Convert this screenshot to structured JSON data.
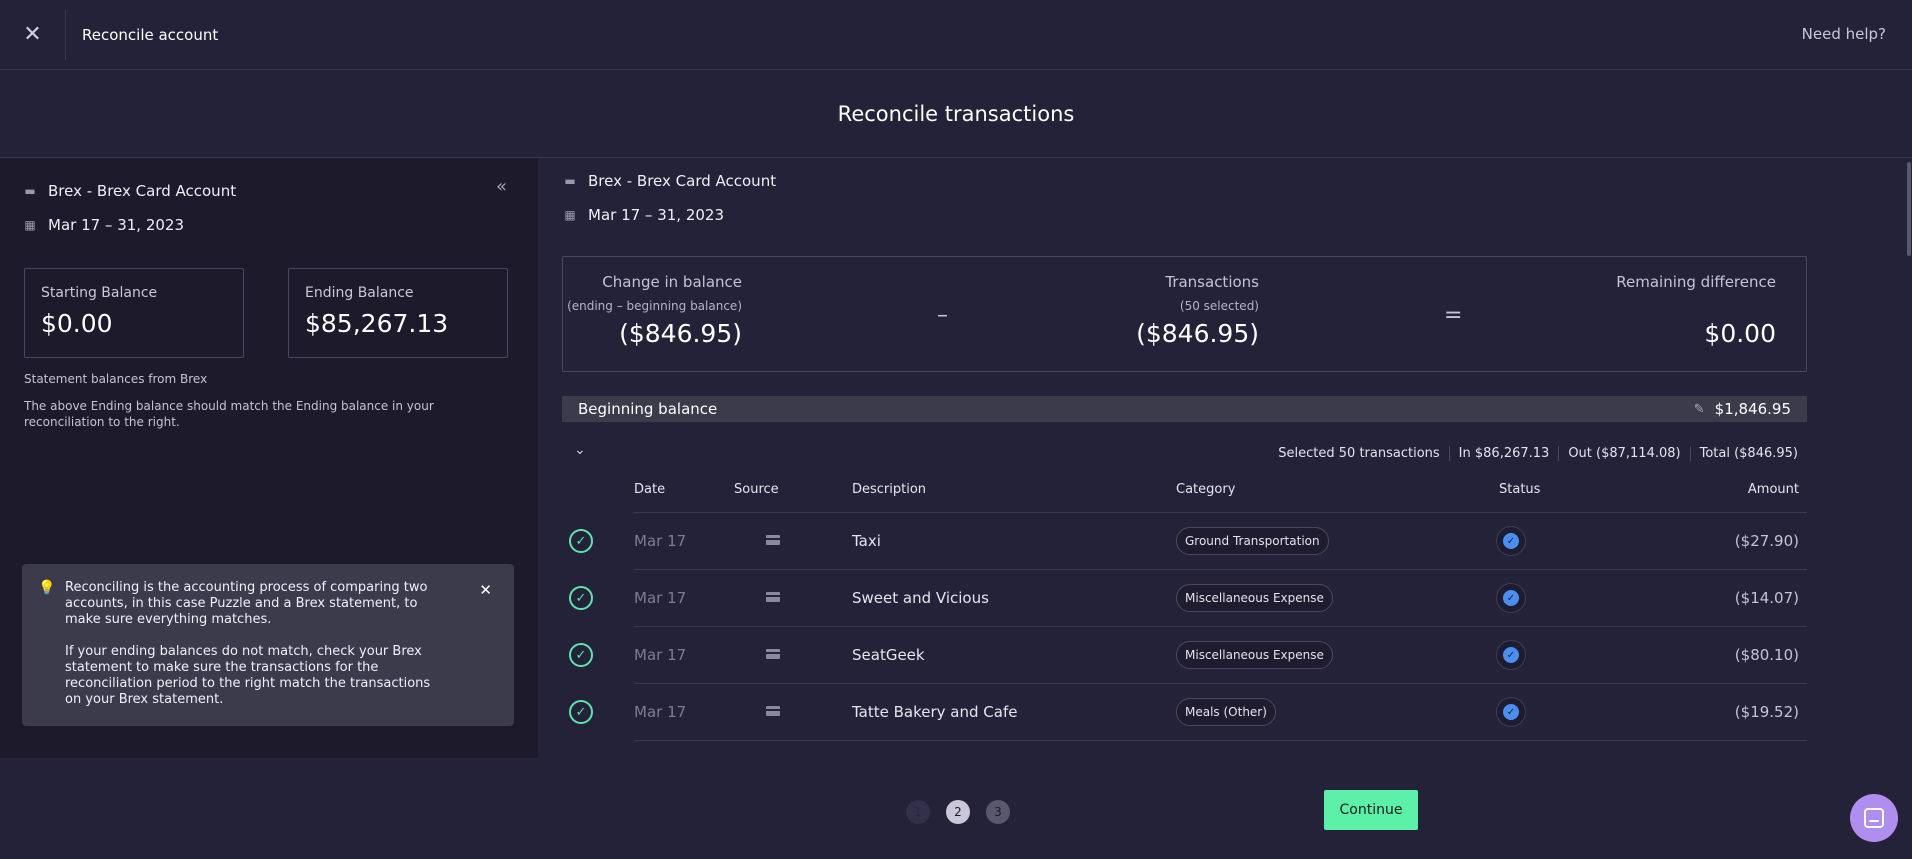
{
  "topbar": {
    "title": "Reconcile account",
    "help": "Need help?",
    "close_glyph": "✕"
  },
  "page_title": "Reconcile transactions",
  "left": {
    "account": "Brex - Brex Card Account",
    "period": "Mar 17 – 31, 2023",
    "starting_label": "Starting Balance",
    "starting_value": "$0.00",
    "ending_label": "Ending Balance",
    "ending_value": "$85,267.13",
    "note1": "Statement balances from Brex",
    "note2": "The above Ending balance should match the Ending balance in your reconciliation to the right.",
    "tip1": "Reconciling is the accounting process of comparing two accounts, in this case Puzzle and a Brex statement, to make sure everything matches.",
    "tip2": "If your ending balances do not match, check your Brex statement to make sure the transactions for the reconciliation period to the right match the transactions on your Brex statement."
  },
  "right": {
    "account": "Brex - Brex Card Account",
    "period": "Mar 17 – 31, 2023",
    "summary": {
      "change_label": "Change in balance",
      "change_sub": "(ending – beginning balance)",
      "change_value": "($846.95)",
      "minus": "–",
      "tx_label": "Transactions",
      "tx_sub": "(50 selected)",
      "tx_value": "($846.95)",
      "equals": "=",
      "remaining_label": "Remaining difference",
      "remaining_value": "$0.00"
    },
    "beginning_balance_label": "Beginning balance",
    "beginning_balance_value": "$1,846.95",
    "selection": {
      "selected": "Selected 50 transactions",
      "in": "In $86,267.13",
      "out": "Out ($87,114.08)",
      "total": "Total ($846.95)"
    },
    "columns": {
      "date": "Date",
      "source": "Source",
      "description": "Description",
      "category": "Category",
      "status": "Status",
      "amount": "Amount"
    },
    "rows": [
      {
        "date": "Mar 17",
        "description": "Taxi",
        "category": "Ground Transportation",
        "amount": "($27.90)"
      },
      {
        "date": "Mar 17",
        "description": "Sweet and Vicious",
        "category": "Miscellaneous Expense",
        "amount": "($14.07)"
      },
      {
        "date": "Mar 17",
        "description": "SeatGeek",
        "category": "Miscellaneous Expense",
        "amount": "($80.10)"
      },
      {
        "date": "Mar 17",
        "description": "Tatte Bakery and Cafe",
        "category": "Meals (Other)",
        "amount": "($19.52)"
      }
    ]
  },
  "footer": {
    "pages": [
      "1",
      "2",
      "3"
    ],
    "continue": "Continue"
  },
  "colors": {
    "accent": "#5cf0a8",
    "status_blue": "#4a8ff0",
    "chat": "#b08ef0"
  }
}
